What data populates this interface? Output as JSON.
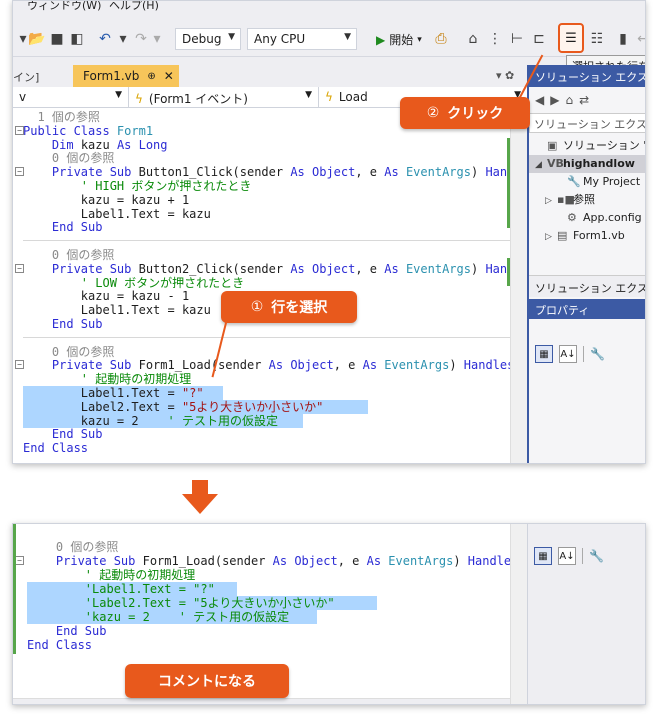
{
  "menu": {
    "window_label": "ウィンドウ(W)",
    "help_label": "ヘルプ(H)"
  },
  "toolbar": {
    "config": "Debug",
    "platform": "Any CPU",
    "start_label": "開始",
    "tooltip": "選択された行をコ"
  },
  "tabs": {
    "left_fragment": "イン]",
    "active": "Form1.vb",
    "pin": "⊕",
    "close": "✕",
    "tools": "▾ ✿"
  },
  "navbar": {
    "left": "v",
    "events": "(Form1 イベント)",
    "method": "Load"
  },
  "callouts": {
    "step1_num": "①",
    "step1_text": "行を選択",
    "step2_num": "②",
    "step2_text": "クリック",
    "result": "コメントになる"
  },
  "code_top": [
    [
      [
        "t-ref",
        "  1 個の参照"
      ]
    ],
    [
      [
        "t-kw",
        "Public Class "
      ],
      [
        "t-type",
        "Form1"
      ]
    ],
    [
      [
        "t-plain",
        "    "
      ],
      [
        "t-kw",
        "Dim "
      ],
      [
        "t-plain",
        "kazu "
      ],
      [
        "t-kw",
        "As Long"
      ]
    ],
    [
      [
        "t-ref",
        "    0 個の参照"
      ]
    ],
    [
      [
        "t-plain",
        "    "
      ],
      [
        "t-kw",
        "Private Sub "
      ],
      [
        "t-plain",
        "Button1_Click(sender "
      ],
      [
        "t-kw",
        "As Object"
      ],
      [
        "t-plain",
        ", e "
      ],
      [
        "t-kw",
        "As "
      ],
      [
        "t-type",
        "EventArgs"
      ],
      [
        "t-plain",
        ") "
      ],
      [
        "t-kw",
        "Handles"
      ]
    ],
    [
      [
        "t-cmt",
        "        ' HIGH ボタンが押されたとき"
      ]
    ],
    [
      [
        "t-plain",
        "        kazu = kazu + 1"
      ]
    ],
    [
      [
        "t-plain",
        "        Label1.Text = kazu"
      ]
    ],
    [
      [
        "t-plain",
        "    "
      ],
      [
        "t-kw",
        "End Sub"
      ]
    ],
    [
      [
        "t-plain",
        ""
      ]
    ],
    [
      [
        "t-ref",
        "    0 個の参照"
      ]
    ],
    [
      [
        "t-plain",
        "    "
      ],
      [
        "t-kw",
        "Private Sub "
      ],
      [
        "t-plain",
        "Button2_Click(sender "
      ],
      [
        "t-kw",
        "As Object"
      ],
      [
        "t-plain",
        ", e "
      ],
      [
        "t-kw",
        "As "
      ],
      [
        "t-type",
        "EventArgs"
      ],
      [
        "t-plain",
        ") "
      ],
      [
        "t-kw",
        "Handles"
      ]
    ],
    [
      [
        "t-cmt",
        "        ' LOW ボタンが押されたとき"
      ]
    ],
    [
      [
        "t-plain",
        "        kazu = kazu - 1"
      ]
    ],
    [
      [
        "t-plain",
        "        Label1.Text = kazu"
      ]
    ],
    [
      [
        "t-plain",
        "    "
      ],
      [
        "t-kw",
        "End Sub"
      ]
    ],
    [
      [
        "t-plain",
        ""
      ]
    ],
    [
      [
        "t-ref",
        "    0 個の参照"
      ]
    ],
    [
      [
        "t-plain",
        "    "
      ],
      [
        "t-kw",
        "Private Sub "
      ],
      [
        "t-plain",
        "Form1_Load(sender "
      ],
      [
        "t-kw",
        "As Object"
      ],
      [
        "t-plain",
        ", e "
      ],
      [
        "t-kw",
        "As "
      ],
      [
        "t-type",
        "EventArgs"
      ],
      [
        "t-plain",
        ") "
      ],
      [
        "t-kw",
        "Handles "
      ],
      [
        "t-plain",
        "M"
      ]
    ],
    [
      [
        "t-cmt",
        "        ' 起動時の初期処理"
      ]
    ],
    [
      [
        "t-plain",
        "        Label1.Text = "
      ],
      [
        "t-str",
        "\"?\""
      ]
    ],
    [
      [
        "t-plain",
        "        Label2.Text = "
      ],
      [
        "t-str",
        "\"5より大きいか小さいか\""
      ]
    ],
    [
      [
        "t-plain",
        "        kazu = 2    "
      ],
      [
        "t-cmt",
        "' テスト用の仮設定"
      ]
    ],
    [
      [
        "t-plain",
        "    "
      ],
      [
        "t-kw",
        "End Sub"
      ]
    ],
    [
      [
        "t-kw",
        "End Class"
      ]
    ]
  ],
  "code_bottom": [
    [
      [
        "t-ref",
        "    0 個の参照"
      ]
    ],
    [
      [
        "t-plain",
        "    "
      ],
      [
        "t-kw",
        "Private Sub "
      ],
      [
        "t-plain",
        "Form1_Load(sender "
      ],
      [
        "t-kw",
        "As Object"
      ],
      [
        "t-plain",
        ", e "
      ],
      [
        "t-kw",
        "As "
      ],
      [
        "t-type",
        "EventArgs"
      ],
      [
        "t-plain",
        ") "
      ],
      [
        "t-kw",
        "Handles "
      ],
      [
        "t-plain",
        "M"
      ]
    ],
    [
      [
        "t-cmt",
        "        ' 起動時の初期処理"
      ]
    ],
    [
      [
        "t-cmt",
        "        'Label1.Text = \"?\""
      ]
    ],
    [
      [
        "t-cmt",
        "        'Label2.Text = \"5より大きいか小さいか\""
      ]
    ],
    [
      [
        "t-cmt",
        "        'kazu = 2    ' テスト用の仮設定"
      ]
    ],
    [
      [
        "t-plain",
        "    "
      ],
      [
        "t-kw",
        "End Sub"
      ]
    ],
    [
      [
        "t-kw",
        "End Class"
      ]
    ]
  ],
  "solution": {
    "header": "ソリューション エクスプローラー",
    "search": "ソリューション エクスプローラー の検索",
    "items": [
      {
        "label": "ソリューション 'high",
        "icon": "▣",
        "arrow": ""
      },
      {
        "label": "highandlow",
        "icon": "VB",
        "arrow": "◢"
      },
      {
        "label": "My Project",
        "icon": "🔧",
        "arrow": ""
      },
      {
        "label": "参照",
        "icon": "▪■",
        "arrow": "▷"
      },
      {
        "label": "App.config",
        "icon": "⚙",
        "arrow": ""
      },
      {
        "label": "Form1.vb",
        "icon": "▤",
        "arrow": "▷"
      }
    ],
    "footer": "ソリューション エクスプローラー"
  },
  "properties": {
    "header": "プロパティ"
  }
}
